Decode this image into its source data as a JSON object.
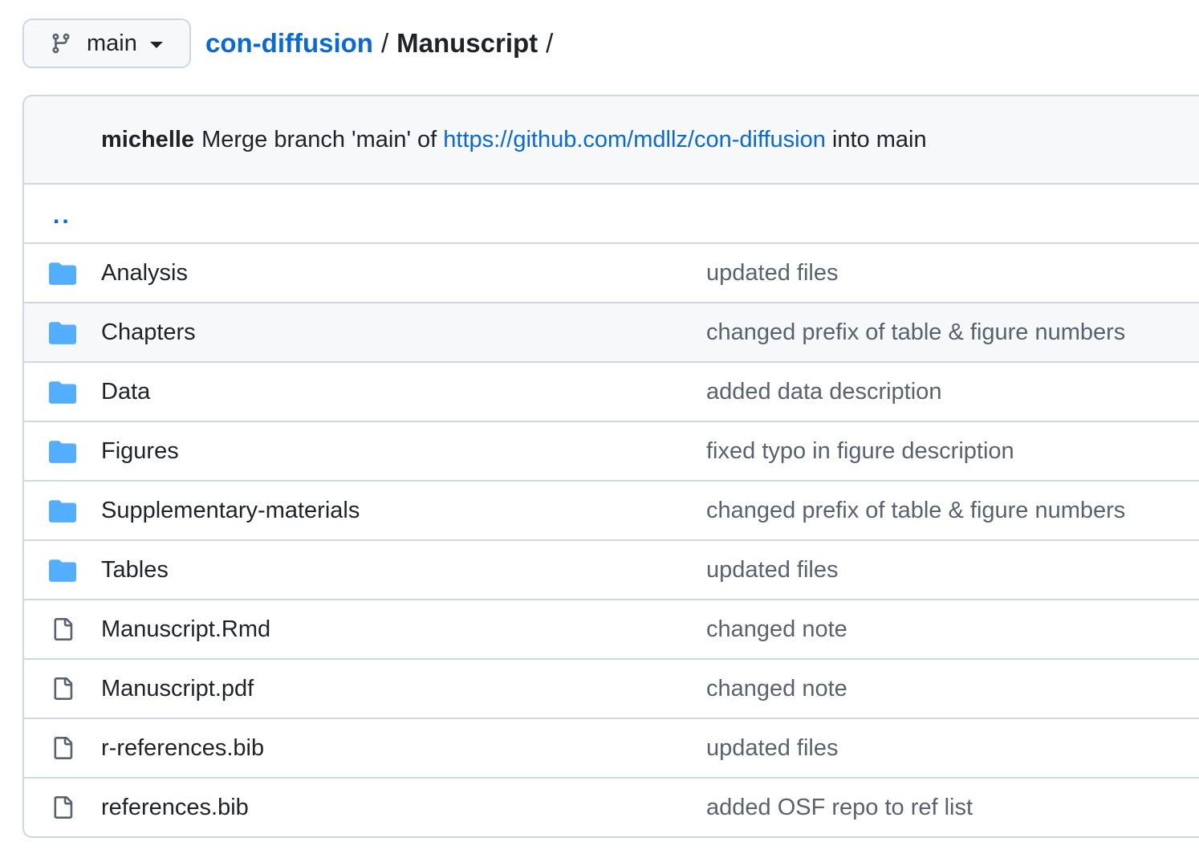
{
  "branch": {
    "label": "main",
    "icon": "git-branch-icon"
  },
  "breadcrumb": {
    "repo": "con-diffusion",
    "separator": "/",
    "dir": "Manuscript",
    "trailing": "/"
  },
  "latest_commit": {
    "author": "michelle",
    "message_before": "Merge branch 'main' of ",
    "link": "https://github.com/mdllz/con-diffusion",
    "message_after": " into main"
  },
  "parent_dir": "..",
  "colors": {
    "link": "#0969da",
    "folder": "#54aeff",
    "muted": "#59636e",
    "border": "#d0d7de",
    "header_bg": "#f6f8fa"
  },
  "files": [
    {
      "name": "Analysis",
      "type": "folder",
      "icon": "folder-icon",
      "message": "updated files"
    },
    {
      "name": "Chapters",
      "type": "folder",
      "icon": "folder-icon",
      "message": "changed prefix of table & figure numbers"
    },
    {
      "name": "Data",
      "type": "folder",
      "icon": "folder-icon",
      "message": "added data description"
    },
    {
      "name": "Figures",
      "type": "folder",
      "icon": "folder-icon",
      "message": "fixed typo in figure description"
    },
    {
      "name": "Supplementary-materials",
      "type": "folder",
      "icon": "folder-icon",
      "message": "changed prefix of table & figure numbers"
    },
    {
      "name": "Tables",
      "type": "folder",
      "icon": "folder-icon",
      "message": "updated files"
    },
    {
      "name": "Manuscript.Rmd",
      "type": "file",
      "icon": "file-icon",
      "message": "changed note"
    },
    {
      "name": "Manuscript.pdf",
      "type": "file",
      "icon": "file-icon",
      "message": "changed note"
    },
    {
      "name": "r-references.bib",
      "type": "file",
      "icon": "file-icon",
      "message": "updated files"
    },
    {
      "name": "references.bib",
      "type": "file",
      "icon": "file-icon",
      "message": "added OSF repo to ref list"
    }
  ]
}
